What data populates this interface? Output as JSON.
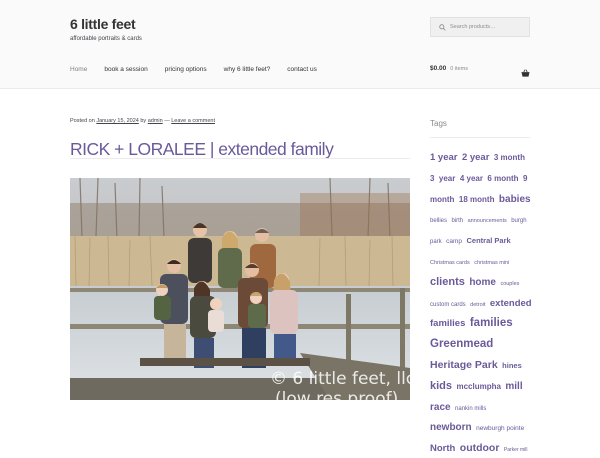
{
  "site": {
    "title": "6 little feet",
    "tagline": "affordable portraits & cards"
  },
  "search": {
    "placeholder": "Search products…"
  },
  "nav": [
    {
      "label": "Home",
      "current": true
    },
    {
      "label": "book a session"
    },
    {
      "label": "pricing options"
    },
    {
      "label": "why 6 little feet?"
    },
    {
      "label": "contact us"
    }
  ],
  "cart": {
    "amount": "$0.00",
    "count": "0 items",
    "icon": "basket-icon"
  },
  "post": {
    "meta_posted": "Posted on",
    "date": "January 15, 2024",
    "meta_by": "by",
    "author": "admin",
    "meta_sep": "—",
    "comment_link": "Leave a comment",
    "title": "RICK + LORALEE | extended family",
    "watermark_line1": "© 6 little feet, llc",
    "watermark_line2": "(low res proof)"
  },
  "sidebar": {
    "title": "Tags",
    "tags": [
      {
        "label": "1 year",
        "size": 9.5
      },
      {
        "label": "2 year",
        "size": 9.5
      },
      {
        "label": "3 month",
        "size": 8
      },
      {
        "label": "3",
        "size": 8
      },
      {
        "label": "year",
        "size": 8
      },
      {
        "label": "4 year",
        "size": 8
      },
      {
        "label": "6 month",
        "size": 8
      },
      {
        "label": "9 month",
        "size": 8
      },
      {
        "label": "18 month",
        "size": 8
      },
      {
        "label": "babies",
        "size": 10
      },
      {
        "label": "bellies",
        "size": 6
      },
      {
        "label": "birth",
        "size": 6
      },
      {
        "label": "announcements",
        "size": 5.5
      },
      {
        "label": "burgh park",
        "size": 6
      },
      {
        "label": "camp",
        "size": 6.5
      },
      {
        "label": "Central Park",
        "size": 7.5
      },
      {
        "label": "Christmas cards",
        "size": 5.5
      },
      {
        "label": "christmas mini",
        "size": 5.5
      },
      {
        "label": "clients",
        "size": 11
      },
      {
        "label": "home",
        "size": 10
      },
      {
        "label": "couples",
        "size": 5.5
      },
      {
        "label": "custom cards",
        "size": 6
      },
      {
        "label": "detroit",
        "size": 5.5
      },
      {
        "label": "extended families",
        "size": 9.5
      },
      {
        "label": "families",
        "size": 11.5
      },
      {
        "label": "Greenmead",
        "size": 11.5
      },
      {
        "label": "Heritage Park",
        "size": 10.5
      },
      {
        "label": "hines",
        "size": 7.5
      },
      {
        "label": "kids",
        "size": 11
      },
      {
        "label": "mcclumpha",
        "size": 8
      },
      {
        "label": "mill",
        "size": 10
      },
      {
        "label": "race",
        "size": 10
      },
      {
        "label": "nankin mills",
        "size": 6
      },
      {
        "label": "newborn",
        "size": 10
      },
      {
        "label": "newburgh pointe",
        "size": 6.5
      },
      {
        "label": "North",
        "size": 9.5
      },
      {
        "label": "outdoor",
        "size": 10.5
      },
      {
        "label": "Parker mill",
        "size": 5
      }
    ]
  },
  "colors": {
    "accent": "#6a5a9a",
    "header_bg": "#fafafa",
    "text": "#43454b"
  }
}
